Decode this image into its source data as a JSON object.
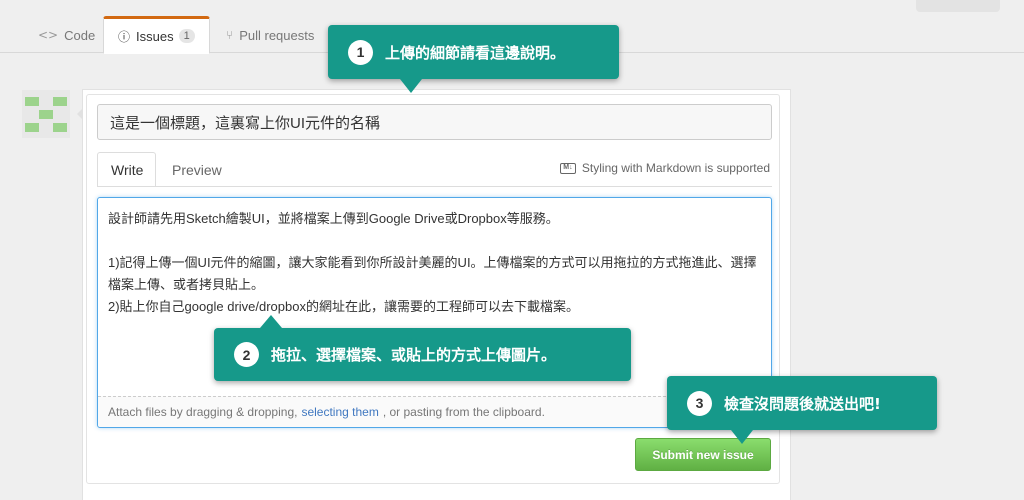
{
  "tabs": [
    {
      "icon": "code-icon",
      "glyph": "<>",
      "label": "Code"
    },
    {
      "icon": "issue-opened-icon",
      "glyph": "ⓘ",
      "label": "Issues",
      "count": "1"
    },
    {
      "icon": "git-pull-request-icon",
      "glyph": "⑂",
      "label": "Pull requests"
    }
  ],
  "issue_form": {
    "title_value": "這是一個標題，這裏寫上你UI元件的名稱",
    "write_tab": "Write",
    "preview_tab": "Preview",
    "markdown_note": "Styling with Markdown is supported",
    "markdown_icon_text": "M↓",
    "body_value": "設計師請先用Sketch繪製UI，並將檔案上傳到Google Drive或Dropbox等服務。\n\n1)記得上傳一個UI元件的縮圖，讓大家能看到你所設計美麗的UI。上傳檔案的方式可以用拖拉的方式拖進此、選擇檔案上傳、或者拷貝貼上。\n2)貼上你自己google drive/dropbox的網址在此，讓需要的工程師可以去下載檔案。",
    "attach_prefix": "Attach files by dragging & dropping,",
    "attach_link": "selecting them",
    "attach_suffix": ", or pasting from the clipboard.",
    "submit_label": "Submit new issue"
  },
  "callouts": [
    {
      "number": "1",
      "text": "上傳的細節請看這邊說明。"
    },
    {
      "number": "2",
      "text": "拖拉、選擇檔案、或貼上的方式上傳圖片。"
    },
    {
      "number": "3",
      "text": "檢查沒問題後就送出吧!"
    }
  ],
  "colors": {
    "callout_bg": "#16998a",
    "submit_green": "#6cc644",
    "link_blue": "#4078c0",
    "active_tab_accent": "#d26911",
    "textarea_focus": "#51a7e8"
  }
}
